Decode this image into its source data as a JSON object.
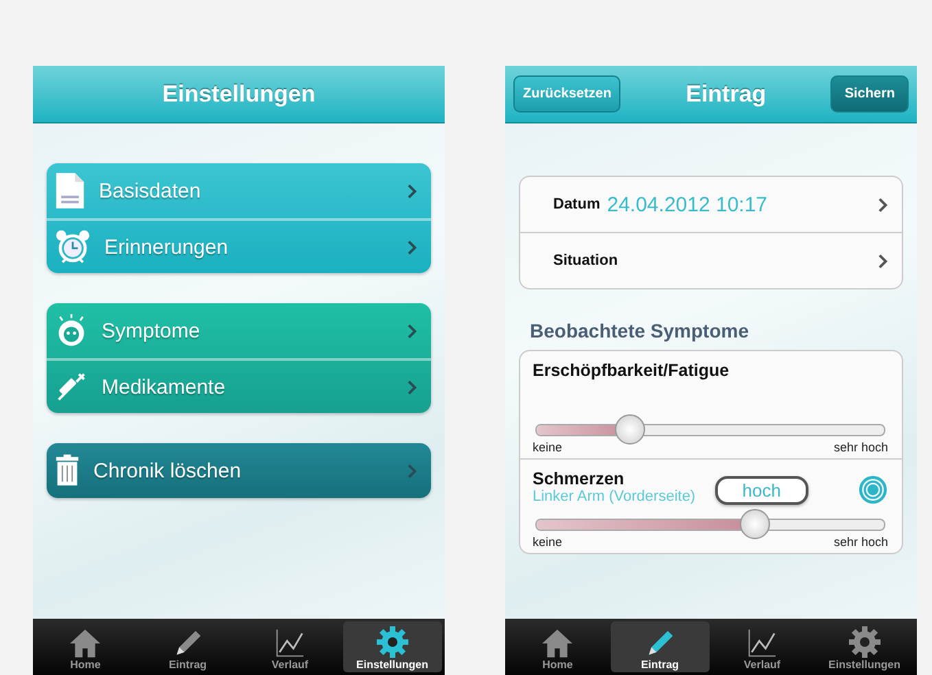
{
  "screens": [
    {
      "title": "Einstellungen",
      "menu_groups": [
        {
          "items": [
            {
              "label": "Basisdaten"
            },
            {
              "label": "Erinnerungen"
            }
          ]
        },
        {
          "items": [
            {
              "label": "Symptome"
            },
            {
              "label": "Medikamente"
            }
          ]
        },
        {
          "items": [
            {
              "label": "Chronik löschen"
            }
          ]
        }
      ],
      "tabs": [
        {
          "label": "Home",
          "selected": false
        },
        {
          "label": "Eintrag",
          "selected": false
        },
        {
          "label": "Verlauf",
          "selected": false
        },
        {
          "label": "Einstellungen",
          "selected": true
        }
      ]
    },
    {
      "title": "Eintrag",
      "left_button": "Zurücksetzen",
      "right_button": "Sichern",
      "fields": [
        {
          "label": "Datum",
          "value": "24.04.2012 10:17"
        },
        {
          "label": "Situation"
        }
      ],
      "section_title": "Beobachtete Symptome",
      "symptoms": [
        {
          "name": "Erschöpfbarkeit/Fatigue",
          "level": 0.27,
          "min_label": "keine",
          "max_label": "sehr hoch"
        },
        {
          "name": "Schmerzen",
          "location": "Linker Arm (Vorderseite)",
          "value_bubble": "hoch",
          "level": 0.63,
          "min_label": "keine",
          "max_label": "sehr hoch"
        }
      ],
      "tabs": [
        {
          "label": "Home",
          "selected": false
        },
        {
          "label": "Eintrag",
          "selected": true
        },
        {
          "label": "Verlauf",
          "selected": false
        },
        {
          "label": "Einstellungen",
          "selected": false
        }
      ]
    }
  ]
}
